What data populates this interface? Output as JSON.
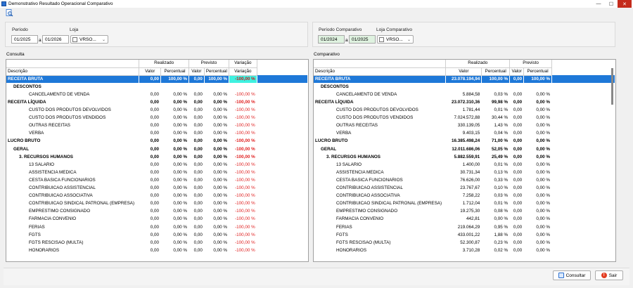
{
  "window": {
    "title": "Demonstrativo Resultado Operacional Comparativo",
    "minimize": "—",
    "maximize": "☐",
    "close": "✕"
  },
  "filters_left": {
    "periodo_label": "Período",
    "periodo_from": "01/2025",
    "sep": "a",
    "periodo_to": "01/2026",
    "loja_label": "Loja",
    "loja_value": "VRSO..."
  },
  "filters_right": {
    "periodo_label": "Período Comparativo",
    "periodo_from": "01/2024",
    "sep": "a",
    "periodo_to": "01/2025",
    "loja_label": "Loja Comparativo",
    "loja_value": "VRSO..."
  },
  "sections": {
    "left": "Consulta",
    "right": "Comparativo"
  },
  "left_grid": {
    "groups": [
      "Realizado",
      "Previsto",
      "Variação"
    ],
    "columns": [
      "Descrição",
      "Valor",
      "Percentual",
      "Valor",
      "Percentual",
      "Variação"
    ],
    "rows": [
      {
        "d": "RECEITA BRUTA",
        "v1": "0,00",
        "p1": "100,00 %",
        "v2": "0,00",
        "p2": "100,00 %",
        "var": "-100,00 %",
        "lvl": 0,
        "b": true,
        "sel": true
      },
      {
        "d": "DESCONTOS",
        "v1": "",
        "p1": "",
        "v2": "",
        "p2": "",
        "var": "",
        "lvl": 1,
        "b": true
      },
      {
        "d": "CANCELAMENTO DE VENDA",
        "v1": "0,00",
        "p1": "0,00 %",
        "v2": "0,00",
        "p2": "0,00 %",
        "var": "-100,00 %",
        "lvl": 2
      },
      {
        "d": "RECEITA LÍQUIDA",
        "v1": "0,00",
        "p1": "0,00 %",
        "v2": "0,00",
        "p2": "0,00 %",
        "var": "-100,00 %",
        "lvl": 0,
        "b": true
      },
      {
        "d": "CUSTO DOS PRODUTOS DEVOLVIDOS",
        "v1": "0,00",
        "p1": "0,00 %",
        "v2": "0,00",
        "p2": "0,00 %",
        "var": "-100,00 %",
        "lvl": 2
      },
      {
        "d": "CUSTO DOS PRODUTOS VENDIDOS",
        "v1": "0,00",
        "p1": "0,00 %",
        "v2": "0,00",
        "p2": "0,00 %",
        "var": "-100,00 %",
        "lvl": 2
      },
      {
        "d": "OUTRAS RECEITAS",
        "v1": "0,00",
        "p1": "0,00 %",
        "v2": "0,00",
        "p2": "0,00 %",
        "var": "-100,00 %",
        "lvl": 2
      },
      {
        "d": "VERBA",
        "v1": "0,00",
        "p1": "0,00 %",
        "v2": "0,00",
        "p2": "0,00 %",
        "var": "-100,00 %",
        "lvl": 2
      },
      {
        "d": "LUCRO BRUTO",
        "v1": "0,00",
        "p1": "0,00 %",
        "v2": "0,00",
        "p2": "0,00 %",
        "var": "-100,00 %",
        "lvl": 0,
        "b": true
      },
      {
        "d": "GERAL",
        "v1": "0,00",
        "p1": "0,00 %",
        "v2": "0,00",
        "p2": "0,00 %",
        "var": "-100,00 %",
        "lvl": 1,
        "b": true
      },
      {
        "d": "3. RECURSOS HUMANOS",
        "v1": "0,00",
        "p1": "0,00 %",
        "v2": "0,00",
        "p2": "0,00 %",
        "var": "-100,00 %",
        "lvl": 1.5,
        "b": true
      },
      {
        "d": "13 SALARIO",
        "v1": "0,00",
        "p1": "0,00 %",
        "v2": "0,00",
        "p2": "0,00 %",
        "var": "-100,00 %",
        "lvl": 2
      },
      {
        "d": "ASSISTENCIA MEDICA",
        "v1": "0,00",
        "p1": "0,00 %",
        "v2": "0,00",
        "p2": "0,00 %",
        "var": "-100,00 %",
        "lvl": 2
      },
      {
        "d": "CESTA BASICA FUNCIONARIOS",
        "v1": "0,00",
        "p1": "0,00 %",
        "v2": "0,00",
        "p2": "0,00 %",
        "var": "-100,00 %",
        "lvl": 2
      },
      {
        "d": "CONTRIBUICAO ASSISTENCIAL",
        "v1": "0,00",
        "p1": "0,00 %",
        "v2": "0,00",
        "p2": "0,00 %",
        "var": "-100,00 %",
        "lvl": 2
      },
      {
        "d": "CONTRIBUICAO ASSOCIATIVA",
        "v1": "0,00",
        "p1": "0,00 %",
        "v2": "0,00",
        "p2": "0,00 %",
        "var": "-100,00 %",
        "lvl": 2
      },
      {
        "d": "CONTRIBUICAO SINDICAL PATRONAL (EMPRESA)",
        "v1": "0,00",
        "p1": "0,00 %",
        "v2": "0,00",
        "p2": "0,00 %",
        "var": "-100,00 %",
        "lvl": 2
      },
      {
        "d": "EMPRESTIMO CONSIGNADO",
        "v1": "0,00",
        "p1": "0,00 %",
        "v2": "0,00",
        "p2": "0,00 %",
        "var": "-100,00 %",
        "lvl": 2
      },
      {
        "d": "FARMACIA CONVENIO",
        "v1": "0,00",
        "p1": "0,00 %",
        "v2": "0,00",
        "p2": "0,00 %",
        "var": "-100,00 %",
        "lvl": 2
      },
      {
        "d": "FERIAS",
        "v1": "0,00",
        "p1": "0,00 %",
        "v2": "0,00",
        "p2": "0,00 %",
        "var": "-100,00 %",
        "lvl": 2
      },
      {
        "d": "FGTS",
        "v1": "0,00",
        "p1": "0,00 %",
        "v2": "0,00",
        "p2": "0,00 %",
        "var": "-100,00 %",
        "lvl": 2
      },
      {
        "d": "FGTS RESCISAO (MULTA)",
        "v1": "0,00",
        "p1": "0,00 %",
        "v2": "0,00",
        "p2": "0,00 %",
        "var": "-100,00 %",
        "lvl": 2
      },
      {
        "d": "HONORARIOS",
        "v1": "0,00",
        "p1": "0,00 %",
        "v2": "0,00",
        "p2": "0,00 %",
        "var": "-100,00 %",
        "lvl": 2
      }
    ]
  },
  "right_grid": {
    "groups": [
      "Realizado",
      "Previsto"
    ],
    "columns": [
      "Descrição",
      "Valor",
      "Percentual",
      "Valor",
      "Percentual"
    ],
    "rows": [
      {
        "d": "RECEITA BRUTA",
        "v1": "23.078.194,94",
        "p1": "100,00 %",
        "v2": "0,00",
        "p2": "100,00 %",
        "lvl": 0,
        "b": true,
        "sel": true
      },
      {
        "d": "DESCONTOS",
        "v1": "",
        "p1": "",
        "v2": "",
        "p2": "",
        "lvl": 1,
        "b": true
      },
      {
        "d": "CANCELAMENTO DE VENDA",
        "v1": "5.884,58",
        "p1": "0,03 %",
        "v2": "0,00",
        "p2": "0,00 %",
        "lvl": 2
      },
      {
        "d": "RECEITA LÍQUIDA",
        "v1": "23.072.310,36",
        "p1": "99,98 %",
        "v2": "0,00",
        "p2": "0,00 %",
        "lvl": 0,
        "b": true
      },
      {
        "d": "CUSTO DOS PRODUTOS DEVOLVIDOS",
        "v1": "1.781,44",
        "p1": "0,01 %",
        "v2": "0,00",
        "p2": "0,00 %",
        "lvl": 2
      },
      {
        "d": "CUSTO DOS PRODUTOS VENDIDOS",
        "v1": "7.024.572,88",
        "p1": "30,44 %",
        "v2": "0,00",
        "p2": "0,00 %",
        "lvl": 2
      },
      {
        "d": "OUTRAS RECEITAS",
        "v1": "330.139,05",
        "p1": "1,43 %",
        "v2": "0,00",
        "p2": "0,00 %",
        "lvl": 2
      },
      {
        "d": "VERBA",
        "v1": "9.403,15",
        "p1": "0,04 %",
        "v2": "0,00",
        "p2": "0,00 %",
        "lvl": 2
      },
      {
        "d": "LUCRO BRUTO",
        "v1": "16.385.498,24",
        "p1": "71,00 %",
        "v2": "0,00",
        "p2": "0,00 %",
        "lvl": 0,
        "b": true
      },
      {
        "d": "GERAL",
        "v1": "12.011.686,06",
        "p1": "52,05 %",
        "v2": "0,00",
        "p2": "0,00 %",
        "lvl": 1,
        "b": true
      },
      {
        "d": "3. RECURSOS HUMANOS",
        "v1": "5.882.559,91",
        "p1": "25,49 %",
        "v2": "0,00",
        "p2": "0,00 %",
        "lvl": 1.5,
        "b": true
      },
      {
        "d": "13 SALARIO",
        "v1": "1.400,00",
        "p1": "0,01 %",
        "v2": "0,00",
        "p2": "0,00 %",
        "lvl": 2
      },
      {
        "d": "ASSISTENCIA MEDICA",
        "v1": "30.731,34",
        "p1": "0,13 %",
        "v2": "0,00",
        "p2": "0,00 %",
        "lvl": 2
      },
      {
        "d": "CESTA BASICA FUNCIONARIOS",
        "v1": "76.626,00",
        "p1": "0,33 %",
        "v2": "0,00",
        "p2": "0,00 %",
        "lvl": 2
      },
      {
        "d": "CONTRIBUICAO ASSISTENCIAL",
        "v1": "23.767,67",
        "p1": "0,10 %",
        "v2": "0,00",
        "p2": "0,00 %",
        "lvl": 2
      },
      {
        "d": "CONTRIBUICAO ASSOCIATIVA",
        "v1": "7.258,22",
        "p1": "0,03 %",
        "v2": "0,00",
        "p2": "0,00 %",
        "lvl": 2
      },
      {
        "d": "CONTRIBUICAO SINDICAL PATRONAL (EMPRESA)",
        "v1": "1.712,04",
        "p1": "0,01 %",
        "v2": "0,00",
        "p2": "0,00 %",
        "lvl": 2
      },
      {
        "d": "EMPRESTIMO CONSIGNADO",
        "v1": "19.275,30",
        "p1": "0,08 %",
        "v2": "0,00",
        "p2": "0,00 %",
        "lvl": 2
      },
      {
        "d": "FARMACIA CONVENIO",
        "v1": "442,81",
        "p1": "0,00 %",
        "v2": "0,00",
        "p2": "0,00 %",
        "lvl": 2
      },
      {
        "d": "FERIAS",
        "v1": "219.064,29",
        "p1": "0,95 %",
        "v2": "0,00",
        "p2": "0,00 %",
        "lvl": 2
      },
      {
        "d": "FGTS",
        "v1": "433.001,22",
        "p1": "1,88 %",
        "v2": "0,00",
        "p2": "0,00 %",
        "lvl": 2
      },
      {
        "d": "FGTS RESCISAO (MULTA)",
        "v1": "52.300,87",
        "p1": "0,23 %",
        "v2": "0,00",
        "p2": "0,00 %",
        "lvl": 2
      },
      {
        "d": "HONORARIOS",
        "v1": "3.710,28",
        "p1": "0,02 %",
        "v2": "0,00",
        "p2": "0,00 %",
        "lvl": 2
      }
    ]
  },
  "buttons": {
    "consultar": "Consultar",
    "sair": "Sair",
    "sair_icon": "!"
  },
  "colors": {
    "selection": "#1e78d8",
    "variation_highlight": "#3ff1e0",
    "negative": "#e02020",
    "date_green": "#dff2e0"
  },
  "icons": {
    "toolbar": "magnifier-document-icon",
    "consultar": "magnifier-document-icon",
    "sair": "exclamation-icon"
  }
}
